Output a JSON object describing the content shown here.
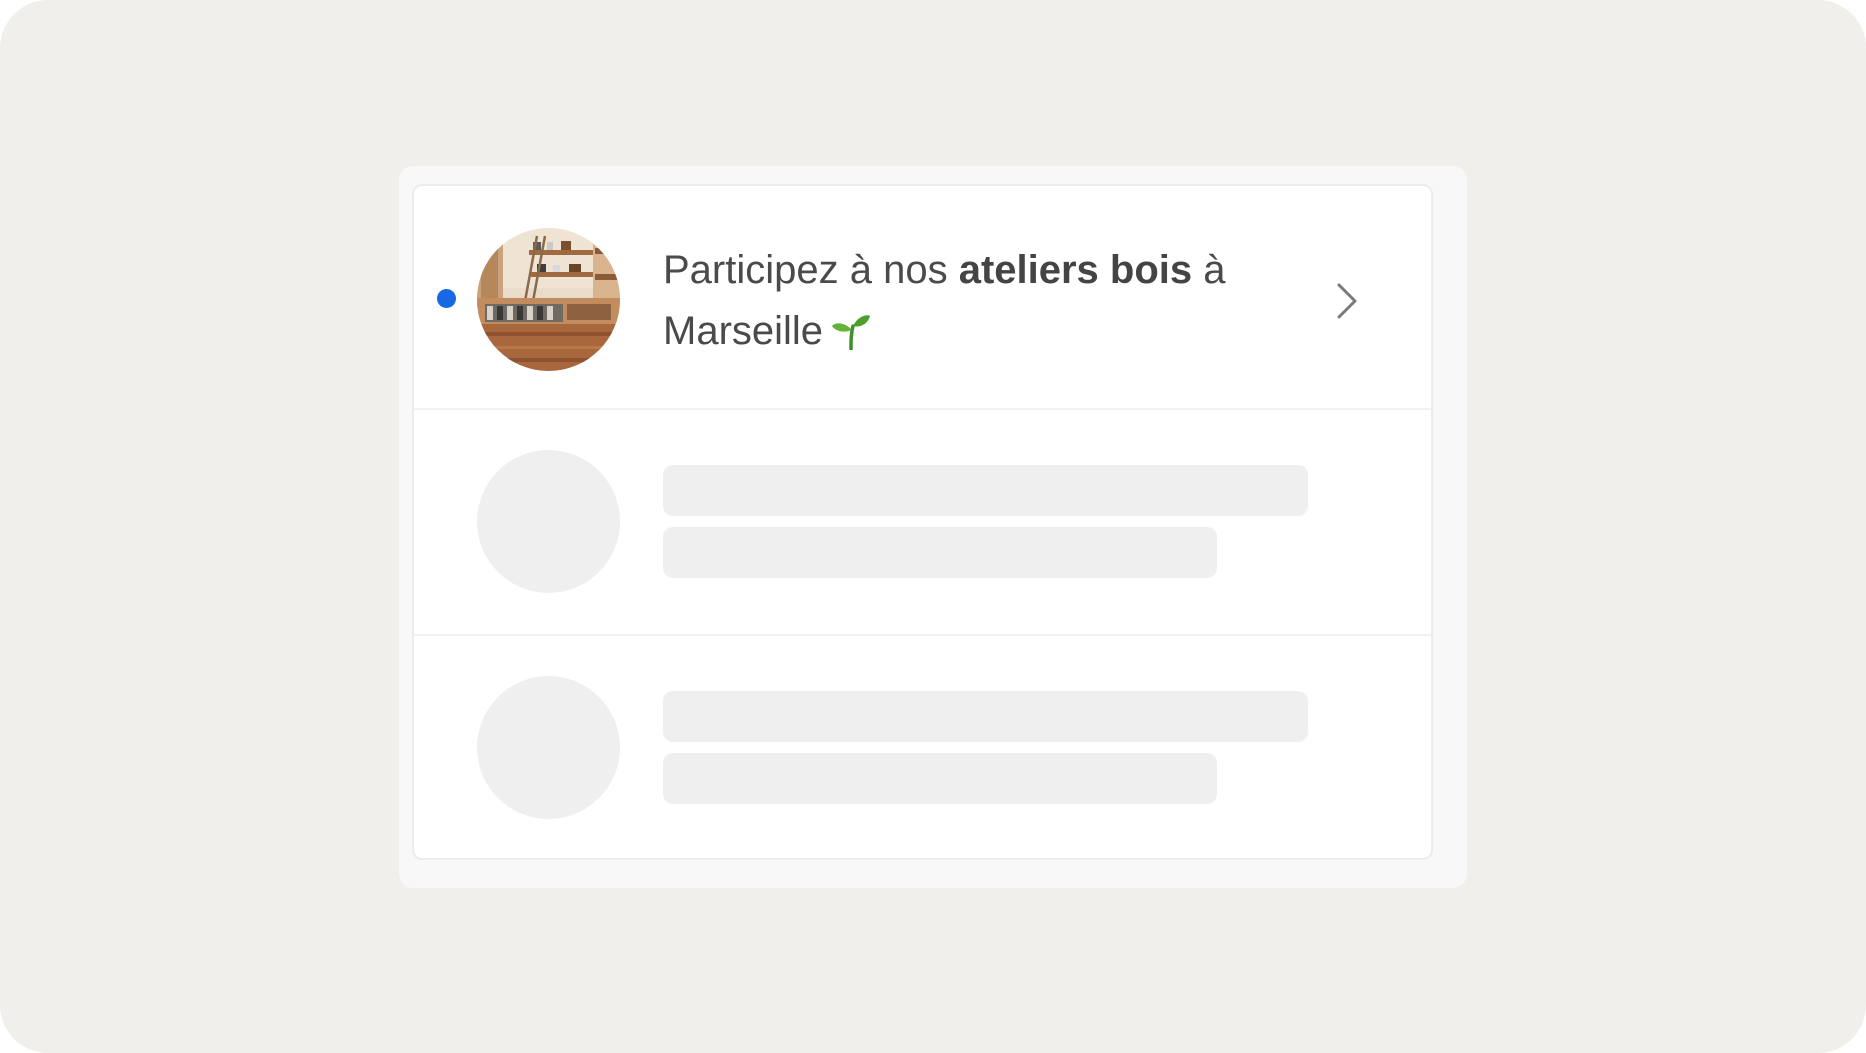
{
  "notification": {
    "unread": true,
    "dot_color": "#1668e3",
    "avatar_icon": "workshop-photo",
    "text_before": "Participez à nos ",
    "text_bold": "ateliers bois",
    "text_after": " à Marseille",
    "emoji_icon": "sprout-icon",
    "action_icon": "chevron-right-icon"
  },
  "placeholders": {
    "rows": 2,
    "skeleton_color": "#efefef"
  },
  "colors": {
    "backdrop": "#f0efec",
    "outer_card": "#f8f8f8",
    "panel": "#ffffff",
    "text": "#4a4a4a"
  }
}
